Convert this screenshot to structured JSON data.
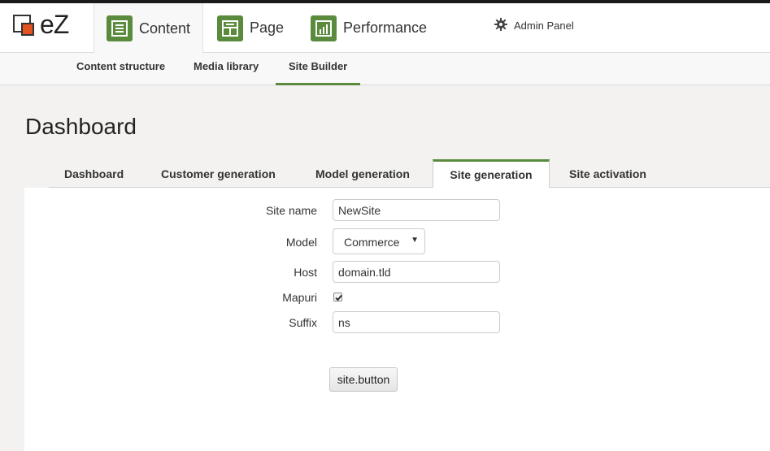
{
  "app": {
    "logo_text": "eZ",
    "admin_label": "Admin Panel"
  },
  "main_tabs": [
    {
      "label": "Content",
      "icon": "content-list-icon",
      "active": true
    },
    {
      "label": "Page",
      "icon": "page-layout-icon",
      "active": false
    },
    {
      "label": "Performance",
      "icon": "bar-chart-icon",
      "active": false
    }
  ],
  "sub_nav": [
    {
      "label": "Content structure",
      "active": false
    },
    {
      "label": "Media library",
      "active": false
    },
    {
      "label": "Site Builder",
      "active": true
    }
  ],
  "page": {
    "title": "Dashboard"
  },
  "dashboard_tabs": [
    {
      "label": "Dashboard",
      "active": false
    },
    {
      "label": "Customer generation",
      "active": false
    },
    {
      "label": "Model generation",
      "active": false
    },
    {
      "label": "Site generation",
      "active": true
    },
    {
      "label": "Site activation",
      "active": false
    }
  ],
  "form": {
    "site_name": {
      "label": "Site name",
      "value": "NewSite"
    },
    "model": {
      "label": "Model",
      "value": "Commerce"
    },
    "host": {
      "label": "Host",
      "value": "domain.tld"
    },
    "mapuri": {
      "label": "Mapuri",
      "checked": true
    },
    "suffix": {
      "label": "Suffix",
      "value": "ns"
    },
    "submit_label": "site.button"
  },
  "colors": {
    "accent": "#5a8b3c",
    "logo_orange": "#e2531f",
    "top_bar": "#1a1a1a"
  }
}
